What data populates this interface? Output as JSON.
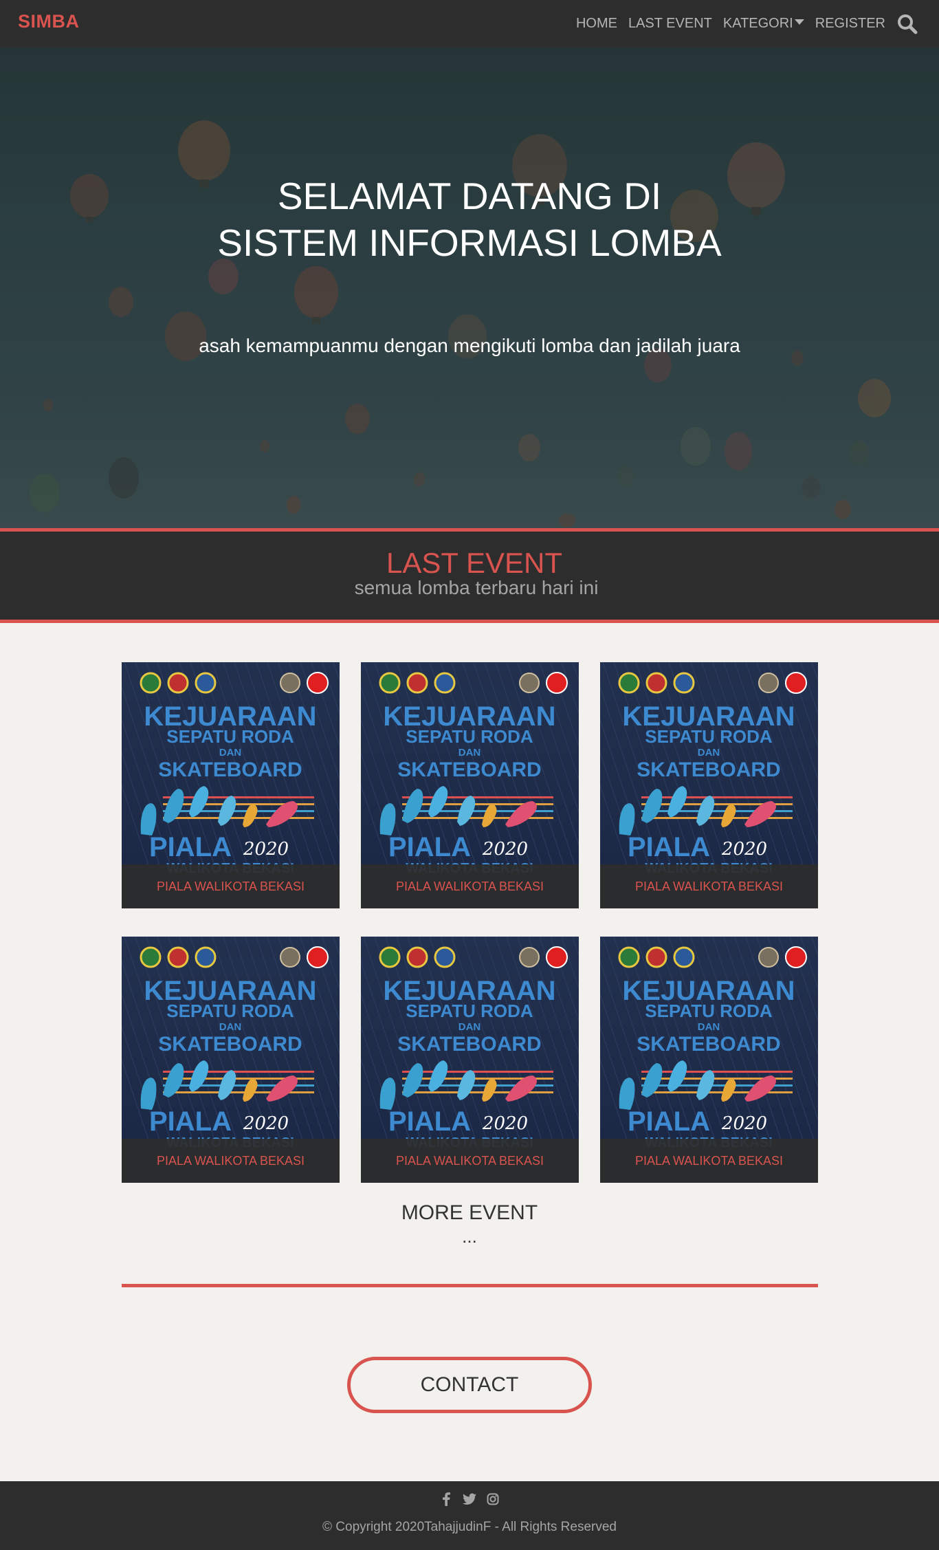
{
  "navbar": {
    "brand": "SIMBA",
    "links": [
      "HOME",
      "LAST EVENT",
      "KATEGORI",
      "REGISTER"
    ],
    "search_icon": "search-icon"
  },
  "hero": {
    "title_line1": "SELAMAT DATANG DI",
    "title_line2": "SISTEM INFORMASI LOMBA",
    "subtitle": "asah kemampuanmu dengan mengikuti lomba dan jadilah juara"
  },
  "last_event": {
    "title": "LAST EVENT",
    "subtitle": "semua lomba terbaru hari ini"
  },
  "events": [
    {
      "caption": "PIALA WALIKOTA BEKASI"
    },
    {
      "caption": "PIALA WALIKOTA BEKASI"
    },
    {
      "caption": "PIALA WALIKOTA BEKASI"
    },
    {
      "caption": "PIALA WALIKOTA BEKASI"
    },
    {
      "caption": "PIALA WALIKOTA BEKASI"
    },
    {
      "caption": "PIALA WALIKOTA BEKASI"
    }
  ],
  "poster": {
    "line1": "KEJUARAAN",
    "line2": "SEPATU RODA",
    "line3": "DAN",
    "line4": "SKATEBOARD",
    "line5": "PIALA",
    "year": "2020",
    "line6": "WALIKOTA BEKASI"
  },
  "more_event": {
    "label": "MORE EVENT",
    "dots": "..."
  },
  "contact": {
    "label": "CONTACT"
  },
  "footer": {
    "social_icons": [
      "facebook-icon",
      "twitter-icon",
      "instagram-icon"
    ],
    "copyright": "© Copyright 2020TahajjudinF - All Rights Reserved"
  },
  "colors": {
    "accent": "#d9534f",
    "dark": "#2d2d2d",
    "page_bg": "#f2f1ee"
  }
}
